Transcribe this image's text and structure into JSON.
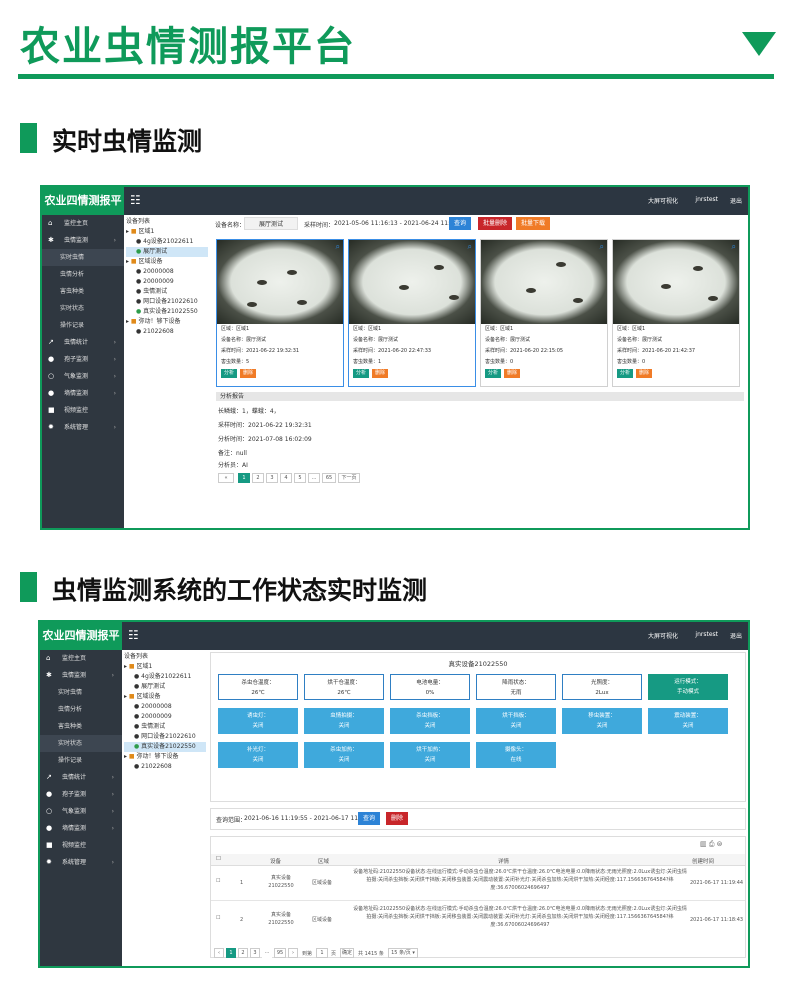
{
  "page_title": "农业虫情测报平台",
  "accent_color": "#0f9a5a",
  "section1": {
    "title": "实时虫情监测"
  },
  "section2": {
    "title": "虫情监测系统的工作状态实时监测"
  },
  "app": {
    "brand1": "农业四情测报平台",
    "brand2": "农业四情测报平台",
    "top_right": [
      "大屏可视化",
      "jnrstest",
      "退出"
    ]
  },
  "sidebar1": {
    "main_home": "监控主页",
    "pest": "虫情监测",
    "subs": [
      "实时虫情",
      "虫情分析",
      "害虫种类",
      "实时状态",
      "操作记录"
    ],
    "rest": [
      "虫情统计",
      "孢子监测",
      "气象监测",
      "墒情监测",
      "视频监控",
      "系统管理"
    ]
  },
  "sidebar2": {
    "main_home": "监控主页",
    "pest": "虫情监测",
    "subs": [
      "实时虫情",
      "虫情分析",
      "害虫种类",
      "实时状态",
      "操作记录"
    ],
    "rest": [
      "虫情统计",
      "孢子监测",
      "气象监测",
      "墒情监测",
      "视频监控",
      "系统管理"
    ]
  },
  "tree": {
    "header": "设备列表",
    "area1": "区域1",
    "area1_items": [
      "4g设备21022611",
      "展厅测试"
    ],
    "area2": "区域设备",
    "area2_items": [
      "20000008",
      "20000009",
      "虫情测试",
      "网口设备21022610",
      "真实设备21022550"
    ],
    "area3": "弥动！够下设备",
    "area3_items": [
      "21022608"
    ]
  },
  "tree2": {
    "header": "设备列表",
    "area1": "区域1",
    "area1_items": [
      "4g设备21022611",
      "展厅测试"
    ],
    "area2": "区域设备",
    "area2_items": [
      "20000008",
      "20000009",
      "虫情测试",
      "网口设备21022610",
      "真实设备21022550"
    ],
    "area3": "弥动！够下设备",
    "area3_items": [
      "21022608"
    ]
  },
  "filter": {
    "device_label": "设备名称：",
    "device_value": "展厅测试",
    "time_label": "采样时间：",
    "time_value": "2021-05-06 11:16:13 - 2021-06-24 11:16:13",
    "query": "查询",
    "batch_delete": "批量删除",
    "batch_download": "批量下载"
  },
  "cards": [
    {
      "area": "区域：区域1",
      "device": "设备名称：展厅测试",
      "time": "采样时间：2021-06-22 19:32:31",
      "count": "害虫数量：5",
      "analyze": "分析",
      "delete": "删除"
    },
    {
      "area": "区域：区域1",
      "device": "设备名称：展厅测试",
      "time": "采样时间：2021-06-20 22:47:33",
      "count": "害虫数量：1",
      "analyze": "分析",
      "delete": "删除"
    },
    {
      "area": "区域：区域1",
      "device": "设备名称：展厅测试",
      "time": "采样时间：2021-06-20 22:15:05",
      "count": "害虫数量：0",
      "analyze": "分析",
      "delete": "删除"
    },
    {
      "area": "区域：区域1",
      "device": "设备名称：展厅测试",
      "time": "采样时间：2021-06-20 21:42:37",
      "count": "害虫数量：0",
      "analyze": "分析",
      "delete": "删除"
    }
  ],
  "report": {
    "title": "分析报告",
    "lines": [
      "长鳞蛾：1，蝶蛾：4，",
      "采样时间：2021-06-22 19:32:31",
      "分析时间：2021-07-08 16:02:09",
      "备注：null",
      "分析员：AI"
    ]
  },
  "pagination1": [
    "1",
    "2",
    "3",
    "4",
    "5",
    "...",
    "65",
    "下一页"
  ],
  "status": {
    "device_title": "真实设备21022550",
    "row1": [
      {
        "label": "杀虫仓温度：",
        "value": "26℃"
      },
      {
        "label": "烘干仓温度：",
        "value": "26℃"
      },
      {
        "label": "电池电量：",
        "value": "0%"
      },
      {
        "label": "降雨状态：",
        "value": "无雨"
      },
      {
        "label": "光照度：",
        "value": "2Lux"
      },
      {
        "label": "运行模式：",
        "value": "手动模式"
      }
    ],
    "row2": [
      {
        "label": "诱虫灯：",
        "value": "关闭"
      },
      {
        "label": "虫情拍摄：",
        "value": "关闭"
      },
      {
        "label": "杀虫挡板：",
        "value": "关闭"
      },
      {
        "label": "烘干挡板：",
        "value": "关闭"
      },
      {
        "label": "移虫装置：",
        "value": "关闭"
      },
      {
        "label": "震动装置：",
        "value": "关闭"
      }
    ],
    "row3": [
      {
        "label": "补光灯：",
        "value": "关闭"
      },
      {
        "label": "杀虫加热：",
        "value": "关闭"
      },
      {
        "label": "烘干加热：",
        "value": "关闭"
      },
      {
        "label": "摄像头：",
        "value": "在线"
      }
    ]
  },
  "query2": {
    "label": "查询范围：",
    "value": "2021-06-16 11:19:55 - 2021-06-17 11:19:55",
    "query": "查询",
    "delete": "删除"
  },
  "table": {
    "headers": [
      "设备",
      "区域",
      "详情",
      "创建时间"
    ],
    "rows": [
      {
        "no": "1",
        "device": "真实设备21022550",
        "area": "区域设备",
        "detail": "设备地址码:21022550设备状态:在线运行模式:手动杀虫仓温度:26.0℃烘干仓温度:26.0℃电池电量:0.0降雨状态:无雨光照度:2.0Lux诱虫灯:关闭虫情拍摄:关闭杀虫挡板:关闭烘干挡板:关闭移虫装置:关闭震动装置:关闭补光灯:关闭杀虫加热:关闭烘干加热:关闭经度:117.156636764584?纬度:36.67006024696497",
        "time": "2021-06-17 11:19:44"
      },
      {
        "no": "2",
        "device": "真实设备21022550",
        "area": "区域设备",
        "detail": "设备地址码:21022550设备状态:在线运行模式:手动杀虫仓温度:26.0℃烘干仓温度:26.0℃电池电量:0.0降雨状态:无雨光照度:2.0Lux诱虫灯:关闭虫情拍摄:关闭杀虫挡板:关闭烘干挡板:关闭移虫装置:关闭震动装置:关闭补光灯:关闭杀虫加热:关闭烘干加热:关闭经度:117.156636764584?纬度:36.67006024696497",
        "time": "2021-06-17 11:18:43"
      }
    ]
  },
  "pagination2": {
    "pages": [
      "1",
      "2",
      "3",
      "...",
      "95"
    ],
    "goto": "到第",
    "page": "1",
    "unit": "页",
    "confirm": "确定",
    "total": "共 1415 条",
    "per_page": "15 条/页"
  }
}
